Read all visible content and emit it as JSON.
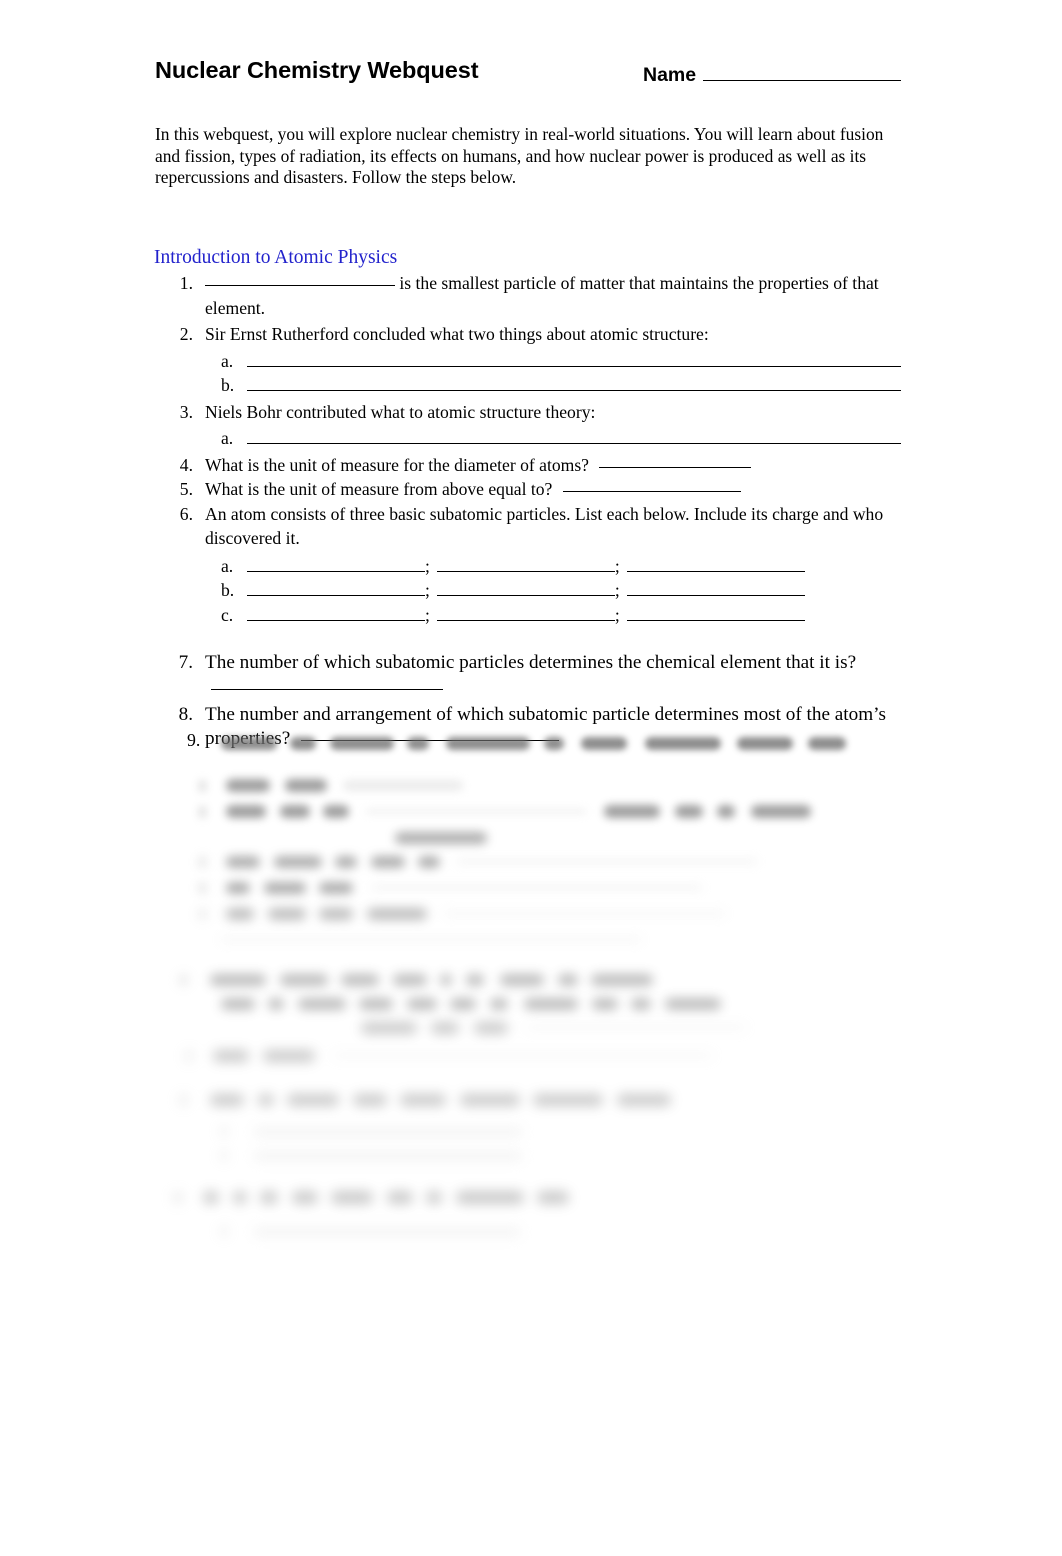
{
  "document": {
    "title": "Nuclear Chemistry Webquest",
    "name_label": "Name",
    "intro_paragraph": "In this webquest, you will explore nuclear chemistry in real-world situations.  You will learn about fusion and fission, types of radiation, its effects on humans, and how nuclear power is produced as well as its repercussions and disasters.   Follow the steps below.",
    "link_color": "#2222cc"
  },
  "section": {
    "heading": "Introduction to Atomic Physics"
  },
  "questions": [
    {
      "number": "1.",
      "pre_blank": true,
      "text": "is the smallest particle of matter that maintains the properties of that element."
    },
    {
      "number": "2.",
      "text": "Sir Ernst Rutherford concluded what two things about atomic structure:",
      "subs": [
        {
          "mark": "a."
        },
        {
          "mark": "b."
        }
      ]
    },
    {
      "number": "3.",
      "text": "Niels Bohr contributed what to atomic structure theory:",
      "subs": [
        {
          "mark": "a."
        }
      ]
    },
    {
      "number": "4.",
      "text": "What is the unit of measure for the diameter of atoms?",
      "trailing_blank_width": 152
    },
    {
      "number": "5.",
      "text": "What is the unit of measure from above equal to?",
      "trailing_blank_width": 178
    },
    {
      "number": "6.",
      "text": "An atom consists of three basic subatomic particles.  List each below. Include its charge and who discovered it.",
      "triple_subs": [
        {
          "mark": "a."
        },
        {
          "mark": "b."
        },
        {
          "mark": "c."
        }
      ],
      "separator": ";"
    },
    {
      "number": "7.",
      "text": "The number of which subatomic particles determines the chemical element that it is?",
      "trailing_blank_width": 232
    },
    {
      "number": "8.",
      "text": "The number and arrangement of which subatomic particle determines most of the atom’s properties?",
      "trailing_blank_width": 258
    },
    {
      "number": "9.",
      "text": "",
      "illegible": true
    }
  ],
  "illegible_tail": {
    "note": "Remaining page content is blurred and unreadable in the screenshot.",
    "visible_markers": [
      "9."
    ]
  }
}
